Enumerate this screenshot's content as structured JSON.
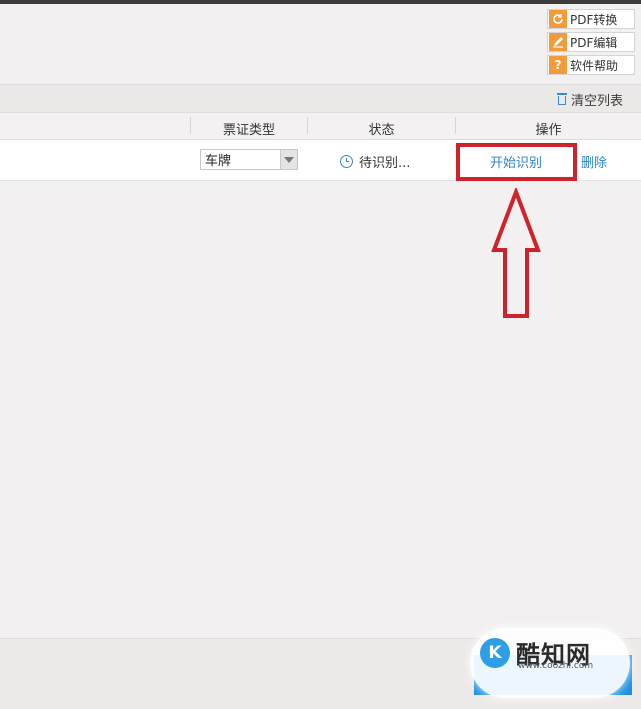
{
  "toolbar": {
    "pdf_convert": "PDF转换",
    "pdf_edit": "PDF编辑",
    "help": "软件帮助",
    "help_icon": "?"
  },
  "list": {
    "clear_label": "清空列表"
  },
  "table": {
    "headers": [
      "票证类型",
      "状态",
      "操作"
    ],
    "rows": [
      {
        "type": "车牌",
        "status": "待识别...",
        "start": "开始识别",
        "delete": "删除"
      }
    ]
  },
  "watermark": {
    "logo": "K",
    "name": "酷知网",
    "url": "www.coozhi.com"
  },
  "colors": {
    "accent": "#2e86d0",
    "highlight": "#d0222a",
    "icon_orange": "#f39b3b"
  }
}
